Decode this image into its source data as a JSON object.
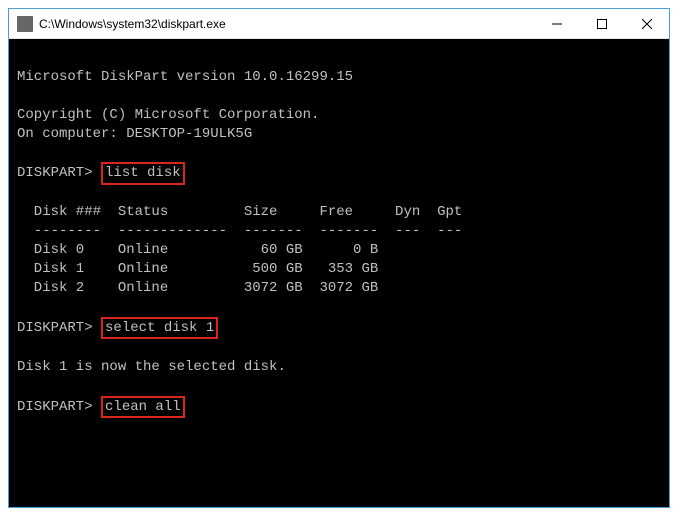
{
  "window": {
    "title": "C:\\Windows\\system32\\diskpart.exe"
  },
  "term": {
    "blank": "",
    "version": "Microsoft DiskPart version 10.0.16299.15",
    "copyright": "Copyright (C) Microsoft Corporation.",
    "computer": "On computer: DESKTOP-19ULK5G",
    "prompt": "DISKPART> ",
    "cmd1": "list disk",
    "header": "  Disk ###  Status         Size     Free     Dyn  Gpt",
    "divider": "  --------  -------------  -------  -------  ---  ---",
    "row0": "  Disk 0    Online           60 GB      0 B",
    "row1": "  Disk 1    Online          500 GB   353 GB",
    "row2": "  Disk 2    Online         3072 GB  3072 GB",
    "cmd2": "select disk 1",
    "selected": "Disk 1 is now the selected disk.",
    "cmd3": "clean all"
  }
}
